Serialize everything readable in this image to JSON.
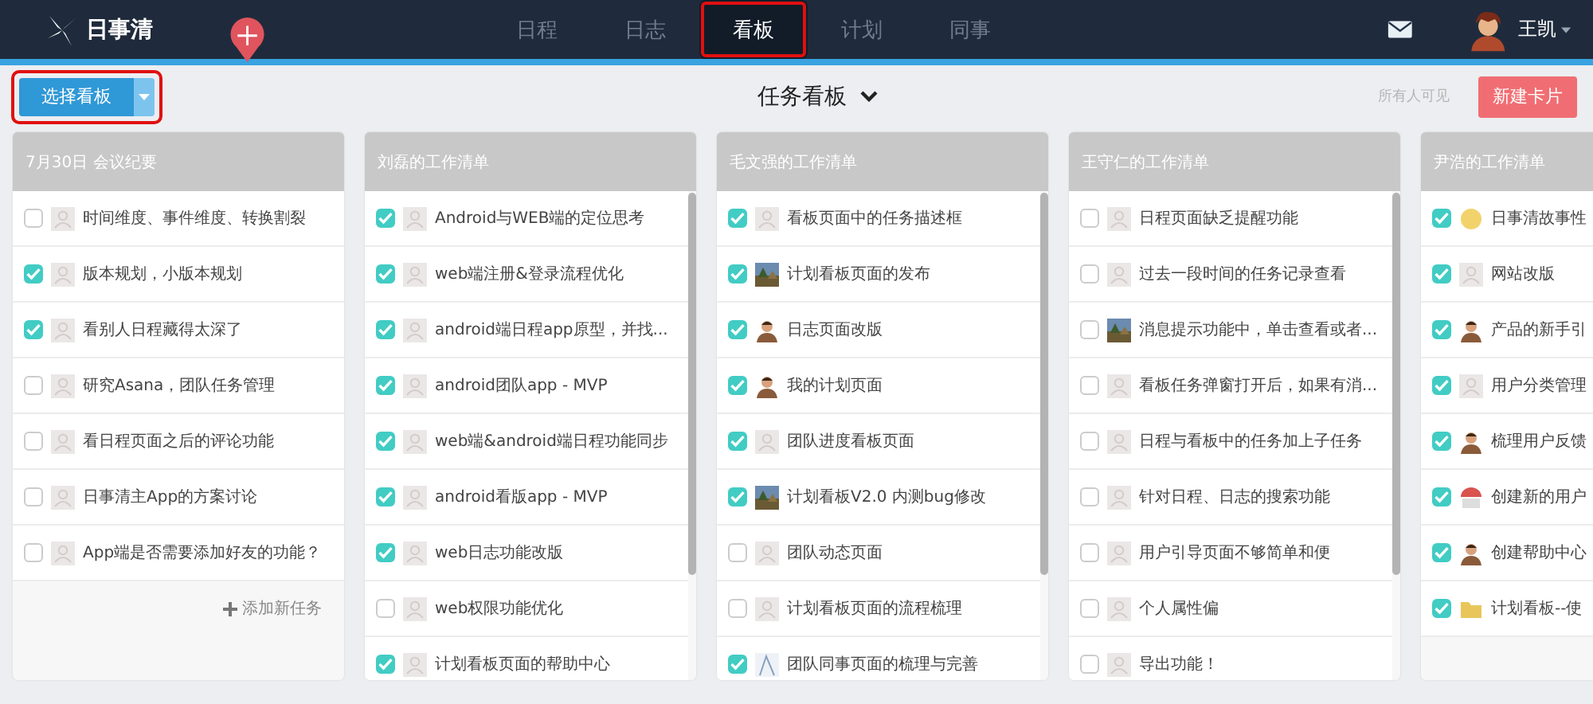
{
  "logo": {
    "text": "日事清"
  },
  "nav": [
    {
      "label": "日程",
      "selected": false,
      "highlighted": false
    },
    {
      "label": "日志",
      "selected": false,
      "highlighted": false
    },
    {
      "label": "看板",
      "selected": true,
      "highlighted": true
    },
    {
      "label": "计划",
      "selected": false,
      "highlighted": false
    },
    {
      "label": "同事",
      "selected": false,
      "highlighted": false
    }
  ],
  "user": {
    "name": "王凯"
  },
  "toolbar": {
    "select_board": {
      "label": "选择看板",
      "highlighted": true
    },
    "board_title": "任务看板",
    "visibility": "所有人可见",
    "new_card": "新建卡片"
  },
  "lists": [
    {
      "title": "7月30日 会议纪要",
      "scrollbar": false,
      "add_task": "添加新任务",
      "tasks": [
        {
          "text": "时间维度、事件维度、转换割裂",
          "checked": false,
          "kind": "blank"
        },
        {
          "text": "版本规划，小版本规划",
          "checked": true,
          "kind": "blank"
        },
        {
          "text": "看别人日程藏得太深了",
          "checked": true,
          "kind": "blank"
        },
        {
          "text": "研究Asana，团队任务管理",
          "checked": false,
          "kind": "blank"
        },
        {
          "text": "看日程页面之后的评论功能",
          "checked": false,
          "kind": "blank"
        },
        {
          "text": "日事清主App的方案讨论",
          "checked": false,
          "kind": "blank"
        },
        {
          "text": "App端是否需要添加好友的功能？",
          "checked": false,
          "kind": "blank"
        }
      ]
    },
    {
      "title": "刘磊的工作清单",
      "scrollbar": true,
      "tasks": [
        {
          "text": "Android与WEB端的定位思考",
          "checked": true,
          "kind": "blank"
        },
        {
          "text": "web端注册&登录流程优化",
          "checked": true,
          "kind": "blank"
        },
        {
          "text": "android端日程app原型，并找...",
          "checked": true,
          "kind": "blank"
        },
        {
          "text": "android团队app - MVP",
          "checked": true,
          "kind": "blank"
        },
        {
          "text": "web端&android端日程功能同步",
          "checked": true,
          "kind": "blank"
        },
        {
          "text": "android看版app - MVP",
          "checked": true,
          "kind": "blank"
        },
        {
          "text": "web日志功能改版",
          "checked": true,
          "kind": "blank"
        },
        {
          "text": "web权限功能优化",
          "checked": false,
          "kind": "blank"
        },
        {
          "text": "计划看板页面的帮助中心",
          "checked": true,
          "kind": "blank"
        }
      ]
    },
    {
      "title": "毛文强的工作清单",
      "scrollbar": true,
      "tasks": [
        {
          "text": "看板页面中的任务描述框",
          "checked": true,
          "kind": "blank"
        },
        {
          "text": "计划看板页面的发布",
          "checked": true,
          "kind": "landscape"
        },
        {
          "text": "日志页面改版",
          "checked": true,
          "kind": "person"
        },
        {
          "text": "我的计划页面",
          "checked": true,
          "kind": "person"
        },
        {
          "text": "团队进度看板页面",
          "checked": true,
          "kind": "blank"
        },
        {
          "text": "计划看板V2.0 内测bug修改",
          "checked": true,
          "kind": "landscape"
        },
        {
          "text": "团队动态页面",
          "checked": false,
          "kind": "blank"
        },
        {
          "text": "计划看板页面的流程梳理",
          "checked": false,
          "kind": "blank"
        },
        {
          "text": "团队同事页面的梳理与完善",
          "checked": true,
          "kind": "sketch"
        }
      ]
    },
    {
      "title": "王守仁的工作清单",
      "scrollbar": true,
      "tasks": [
        {
          "text": "日程页面缺乏提醒功能",
          "checked": false,
          "kind": "blank"
        },
        {
          "text": "过去一段时间的任务记录查看",
          "checked": false,
          "kind": "blank"
        },
        {
          "text": "消息提示功能中，单击查看或者...",
          "checked": false,
          "kind": "landscape"
        },
        {
          "text": "看板任务弹窗打开后，如果有消...",
          "checked": false,
          "kind": "blank"
        },
        {
          "text": "日程与看板中的任务加上子任务",
          "checked": false,
          "kind": "blank"
        },
        {
          "text": "针对日程、日志的搜索功能",
          "checked": false,
          "kind": "blank"
        },
        {
          "text": "用户引导页面不够简单和便",
          "checked": false,
          "kind": "blank"
        },
        {
          "text": "个人属性偏",
          "checked": false,
          "kind": "blank"
        },
        {
          "text": "导出功能！",
          "checked": false,
          "kind": "blank"
        }
      ]
    },
    {
      "title": "尹浩的工作清单",
      "scrollbar": false,
      "tasks": [
        {
          "text": "日事清故事性",
          "checked": true,
          "kind": "face"
        },
        {
          "text": "网站改版",
          "checked": true,
          "kind": "blank"
        },
        {
          "text": "产品的新手引",
          "checked": true,
          "kind": "person"
        },
        {
          "text": "用户分类管理",
          "checked": true,
          "kind": "blank"
        },
        {
          "text": "梳理用户反馈",
          "checked": true,
          "kind": "person"
        },
        {
          "text": "创建新的用户",
          "checked": true,
          "kind": "umbrella"
        },
        {
          "text": "创建帮助中心",
          "checked": true,
          "kind": "person"
        },
        {
          "text": "计划看板--使",
          "checked": true,
          "kind": "folder"
        }
      ]
    }
  ]
}
